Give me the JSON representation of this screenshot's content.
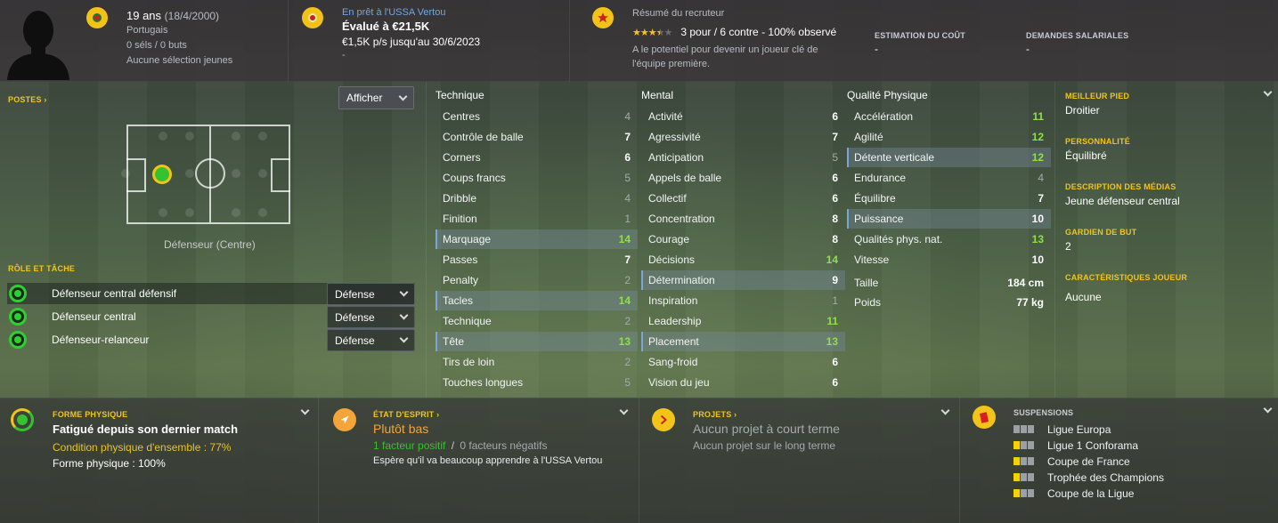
{
  "header": {
    "age": "19 ans",
    "birth": "(18/4/2000)",
    "nationality": "Portugais",
    "caps": "0 séls / 0 buts",
    "youth": "Aucune sélection jeunes",
    "loan_status": "En prêt à l'USSA Vertou",
    "value": "Évalué à €21,5K",
    "wage": "€1,5K p/s jusqu'au 30/6/2023",
    "dash": "-",
    "recruiter_title": "Résumé du recruteur",
    "recruiter_stars": 3.5,
    "recruiter_summary": "3 pour / 6 contre - 100% observé",
    "recruiter_text_1": "A le potentiel pour devenir un joueur clé de",
    "recruiter_text_2": "l'équipe première.",
    "cost_label": "ESTIMATION DU COÛT",
    "cost_value": "-",
    "salary_label": "DEMANDES SALARIALES",
    "salary_value": "-"
  },
  "left": {
    "positions_label": "POSTES ›",
    "show_button": "Afficher",
    "position_caption": "Défenseur (Centre)",
    "roles_label": "RÔLE ET TÂCHE",
    "roles": [
      {
        "name": "Défenseur central défensif",
        "duty": "Défense"
      },
      {
        "name": "Défenseur central",
        "duty": "Défense"
      },
      {
        "name": "Défenseur-relanceur",
        "duty": "Défense"
      }
    ]
  },
  "attributes": {
    "technique_title": "Technique",
    "mental_title": "Mental",
    "physical_title": "Qualité Physique",
    "technique": [
      {
        "n": "Centres",
        "v": "4"
      },
      {
        "n": "Contrôle de balle",
        "v": "7"
      },
      {
        "n": "Corners",
        "v": "6"
      },
      {
        "n": "Coups francs",
        "v": "5"
      },
      {
        "n": "Dribble",
        "v": "4"
      },
      {
        "n": "Finition",
        "v": "1"
      },
      {
        "n": "Marquage",
        "v": "14"
      },
      {
        "n": "Passes",
        "v": "7"
      },
      {
        "n": "Penalty",
        "v": "2"
      },
      {
        "n": "Tacles",
        "v": "14"
      },
      {
        "n": "Technique",
        "v": "2"
      },
      {
        "n": "Tête",
        "v": "13"
      },
      {
        "n": "Tirs de loin",
        "v": "2"
      },
      {
        "n": "Touches longues",
        "v": "5"
      }
    ],
    "mental": [
      {
        "n": "Activité",
        "v": "6"
      },
      {
        "n": "Agressivité",
        "v": "7"
      },
      {
        "n": "Anticipation",
        "v": "5"
      },
      {
        "n": "Appels de balle",
        "v": "6"
      },
      {
        "n": "Collectif",
        "v": "6"
      },
      {
        "n": "Concentration",
        "v": "8"
      },
      {
        "n": "Courage",
        "v": "8"
      },
      {
        "n": "Décisions",
        "v": "14"
      },
      {
        "n": "Détermination",
        "v": "9"
      },
      {
        "n": "Inspiration",
        "v": "1"
      },
      {
        "n": "Leadership",
        "v": "11"
      },
      {
        "n": "Placement",
        "v": "13"
      },
      {
        "n": "Sang-froid",
        "v": "6"
      },
      {
        "n": "Vision du jeu",
        "v": "6"
      }
    ],
    "physical": [
      {
        "n": "Accélération",
        "v": "11"
      },
      {
        "n": "Agilité",
        "v": "12"
      },
      {
        "n": "Détente verticale",
        "v": "12"
      },
      {
        "n": "Endurance",
        "v": "4"
      },
      {
        "n": "Équilibre",
        "v": "7"
      },
      {
        "n": "Puissance",
        "v": "10"
      },
      {
        "n": "Qualités phys. nat.",
        "v": "13"
      },
      {
        "n": "Vitesse",
        "v": "10"
      }
    ],
    "height_label": "Taille",
    "height": "184 cm",
    "weight_label": "Poids",
    "weight": "77 kg"
  },
  "info": {
    "foot_label": "MEILLEUR PIED",
    "foot": "Droitier",
    "personality_label": "PERSONNALITÉ",
    "personality": "Équilibré",
    "media_label": "DESCRIPTION DES MÉDIAS",
    "media": "Jeune défenseur central",
    "gk_label": "GARDIEN DE BUT",
    "gk": "2",
    "traits_label": "CARACTÉRISTIQUES JOUEUR",
    "traits": "Aucune"
  },
  "bottom": {
    "fitness_label": "FORME PHYSIQUE",
    "fitness_title": "Fatigué depuis son dernier match",
    "fitness_condition": "Condition physique d'ensemble : 77%",
    "fitness_form": "Forme physique : 100%",
    "morale_label": "ÉTAT D'ESPRIT ›",
    "morale_title": "Plutôt bas",
    "morale_positive": "1 facteur positif",
    "morale_slash": "/",
    "morale_negative": "0 facteurs négatifs",
    "morale_text": "Espère qu'il va beaucoup apprendre à l'USSA Vertou",
    "projects_label": "PROJETS ›",
    "projects_short": "Aucun projet à court terme",
    "projects_long": "Aucun projet sur le long terme",
    "susp_label": "SUSPENSIONS",
    "competitions": [
      "Ligue Europa",
      "Ligue 1 Conforama",
      "Coupe de France",
      "Trophée des Champions",
      "Coupe de la Ligue"
    ]
  },
  "colors": {
    "accent": "#f2c418",
    "green": "#8ee048",
    "highlight": "#7ba5d8"
  }
}
